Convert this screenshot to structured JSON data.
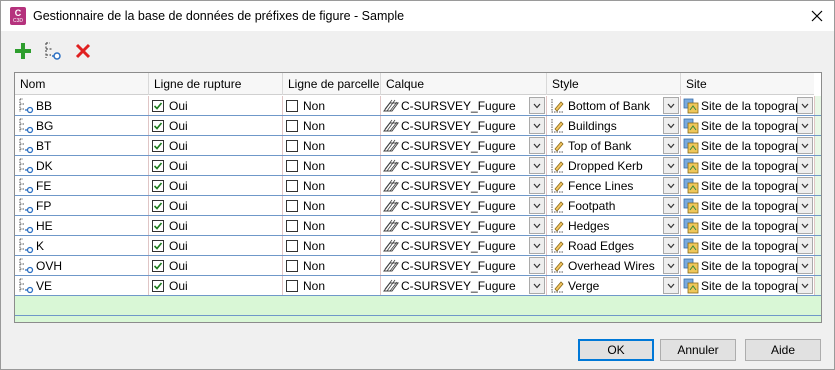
{
  "window": {
    "title": "Gestionnaire de la base de données de préfixes de figure - Sample",
    "app_icon_letter": "C",
    "app_icon_version": "C3D"
  },
  "toolbar": {
    "add_icon": "plus-icon",
    "figure_icon": "figure-prefix-icon",
    "delete_icon": "delete-x-icon"
  },
  "columns": {
    "nom": "Nom",
    "rupture": "Ligne de rupture",
    "parcelle": "Ligne de parcelle",
    "calque": "Calque",
    "style": "Style",
    "site": "Site"
  },
  "rows": [
    {
      "nom": "BB",
      "rupture": "Oui",
      "parcelle": "Non",
      "calque": "C-SURSVEY_Fugure",
      "style": "Bottom of Bank",
      "site": "Site de la topograp"
    },
    {
      "nom": "BG",
      "rupture": "Oui",
      "parcelle": "Non",
      "calque": "C-SURSVEY_Fugure",
      "style": "Buildings",
      "site": "Site de la topograp"
    },
    {
      "nom": "BT",
      "rupture": "Oui",
      "parcelle": "Non",
      "calque": "C-SURSVEY_Fugure",
      "style": "Top of Bank",
      "site": "Site de la topograp"
    },
    {
      "nom": "DK",
      "rupture": "Oui",
      "parcelle": "Non",
      "calque": "C-SURSVEY_Fugure",
      "style": "Dropped Kerb",
      "site": "Site de la topograp"
    },
    {
      "nom": "FE",
      "rupture": "Oui",
      "parcelle": "Non",
      "calque": "C-SURSVEY_Fugure",
      "style": "Fence Lines",
      "site": "Site de la topograp"
    },
    {
      "nom": "FP",
      "rupture": "Oui",
      "parcelle": "Non",
      "calque": "C-SURSVEY_Fugure",
      "style": "Footpath",
      "site": "Site de la topograp"
    },
    {
      "nom": "HE",
      "rupture": "Oui",
      "parcelle": "Non",
      "calque": "C-SURSVEY_Fugure",
      "style": "Hedges",
      "site": "Site de la topograp"
    },
    {
      "nom": "K",
      "rupture": "Oui",
      "parcelle": "Non",
      "calque": "C-SURSVEY_Fugure",
      "style": "Road Edges",
      "site": "Site de la topograp"
    },
    {
      "nom": "OVH",
      "rupture": "Oui",
      "parcelle": "Non",
      "calque": "C-SURSVEY_Fugure",
      "style": "Overhead Wires",
      "site": "Site de la topograp"
    },
    {
      "nom": "VE",
      "rupture": "Oui",
      "parcelle": "Non",
      "calque": "C-SURSVEY_Fugure",
      "style": "Verge",
      "site": "Site de la topograp"
    }
  ],
  "buttons": {
    "ok": "OK",
    "cancel": "Annuler",
    "help": "Aide"
  },
  "colors": {
    "new_row": "#d9f7d6",
    "row_border": "#6f98c9",
    "delete": "#e02020",
    "add": "#2e9e2e",
    "check": "#1c7a1c"
  }
}
